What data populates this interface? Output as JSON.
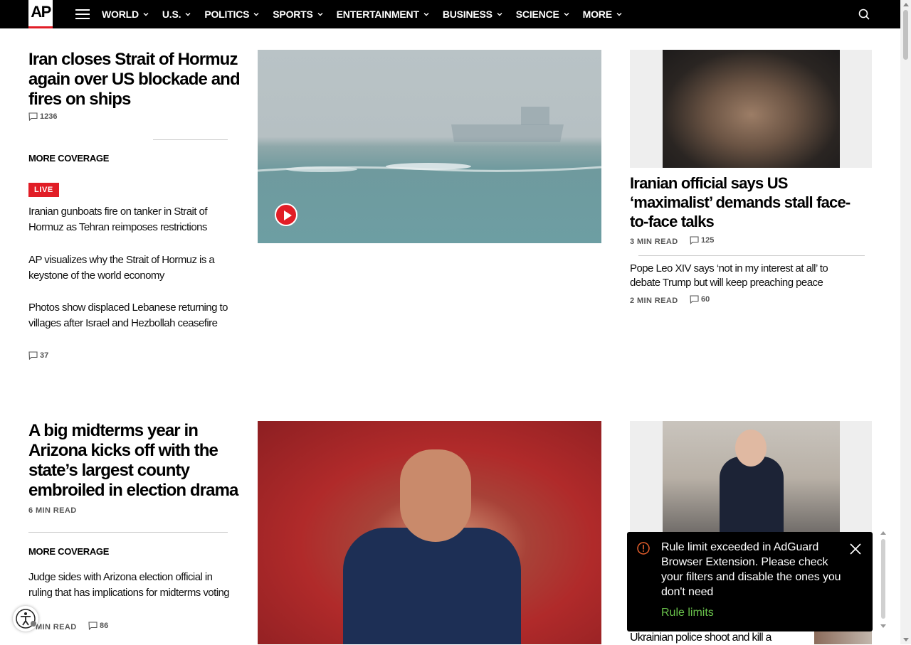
{
  "nav": {
    "logo": "AP",
    "items": [
      "WORLD",
      "U.S.",
      "POLITICS",
      "SPORTS",
      "ENTERTAINMENT",
      "BUSINESS",
      "SCIENCE",
      "MORE"
    ]
  },
  "top": {
    "lead_headline": "Iran closes Strait of Hormuz again over US blockade and fires on ships",
    "lead_comments": "1236",
    "more_coverage": "MORE COVERAGE",
    "live_badge": "LIVE",
    "related": [
      {
        "title": "Iranian gunboats fire on tanker in Strait of Hormuz as Tehran reimposes restrictions"
      },
      {
        "title": "AP visualizes why the Strait of Hormuz is a keystone of the world economy"
      },
      {
        "title": "Photos show displaced Lebanese returning to villages after Israel and Hezbollah ceasefire",
        "comments": "37"
      }
    ],
    "side_headline": "Iranian official says US ‘maximalist’ demands stall face-to-face talks",
    "side_read": "3 MIN READ",
    "side_comments": "125",
    "side2_title": "Pope Leo XIV says ‘not in my interest at all’ to debate Trump but will keep preaching peace",
    "side2_read": "2 MIN READ",
    "side2_comments": "60"
  },
  "second": {
    "lead_headline": "A big midterms year in Arizona kicks off with the state’s largest county embroiled in election drama",
    "lead_read": "6 MIN READ",
    "more_coverage": "MORE COVERAGE",
    "related_title": "Judge sides with Arizona election official in ruling that has implications for midterms voting",
    "related_read": "2 MIN READ",
    "related_comments": "86",
    "side_headline_partial": "Ukrainian police shoot and kill a"
  },
  "toast": {
    "message": "Rule limit exceeded in AdGuard Browser Extension. Please check your filters and disable the ones you don't need",
    "link": "Rule limits"
  },
  "colors": {
    "brand_red": "#e11d26",
    "toast_link": "#69c24b",
    "nav_bg": "#000000"
  }
}
